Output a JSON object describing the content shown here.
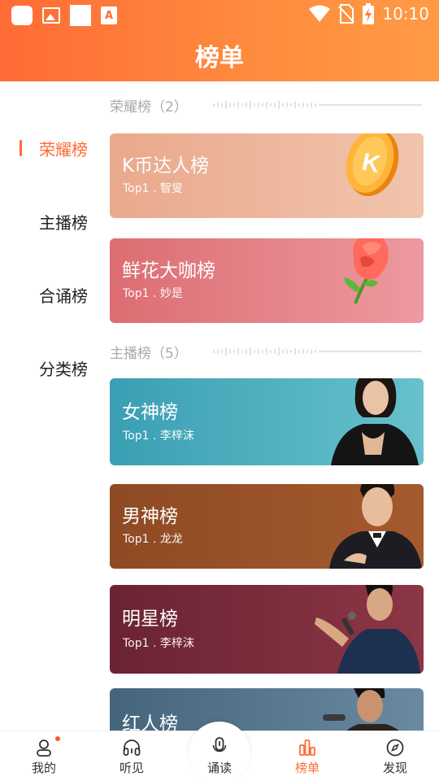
{
  "status_bar": {
    "time": "10:10",
    "notification_letter": "A"
  },
  "header": {
    "title": "榜单"
  },
  "sidenav": {
    "items": [
      {
        "label": "荣耀榜",
        "active": true
      },
      {
        "label": "主播榜",
        "active": false
      },
      {
        "label": "合诵榜",
        "active": false
      },
      {
        "label": "分类榜",
        "active": false
      }
    ]
  },
  "sections": [
    {
      "title": "荣耀榜（2）",
      "cards": [
        {
          "title": "K币达人榜",
          "top": "Top1 . 智叟",
          "color": "#e9a98c",
          "art": "coin-k"
        },
        {
          "title": "鲜花大咖榜",
          "top": "Top1 . 妙是",
          "color": "#e0737a",
          "art": "rose"
        }
      ]
    },
    {
      "title": "主播榜（5）",
      "cards": [
        {
          "title": "女神榜",
          "top": "Top1 . 李梓沫",
          "color": "#3fa6b6",
          "art": "woman-portrait"
        },
        {
          "title": "男神榜",
          "top": "Top1 . 龙龙",
          "color": "#8e4a24",
          "art": "man-portrait"
        },
        {
          "title": "明星榜",
          "top": "Top1 . 李梓沫",
          "color": "#6e2636",
          "art": "singer-portrait"
        },
        {
          "title": "红人榜",
          "top": "",
          "color": "#4a6a80",
          "art": "singer2-portrait"
        }
      ]
    }
  ],
  "bottom_nav": {
    "tabs": [
      {
        "label": "我的",
        "icon": "user-icon",
        "active": false,
        "badge": true
      },
      {
        "label": "听见",
        "icon": "headphones-icon",
        "active": false
      },
      {
        "label": "诵读",
        "icon": "microphone-icon",
        "active": false
      },
      {
        "label": "榜单",
        "icon": "bar-chart-icon",
        "active": true
      },
      {
        "label": "发现",
        "icon": "compass-icon",
        "active": false
      }
    ]
  },
  "colors": {
    "accent": "#ff6b35",
    "header_gradient_end": "#ff9a45"
  }
}
